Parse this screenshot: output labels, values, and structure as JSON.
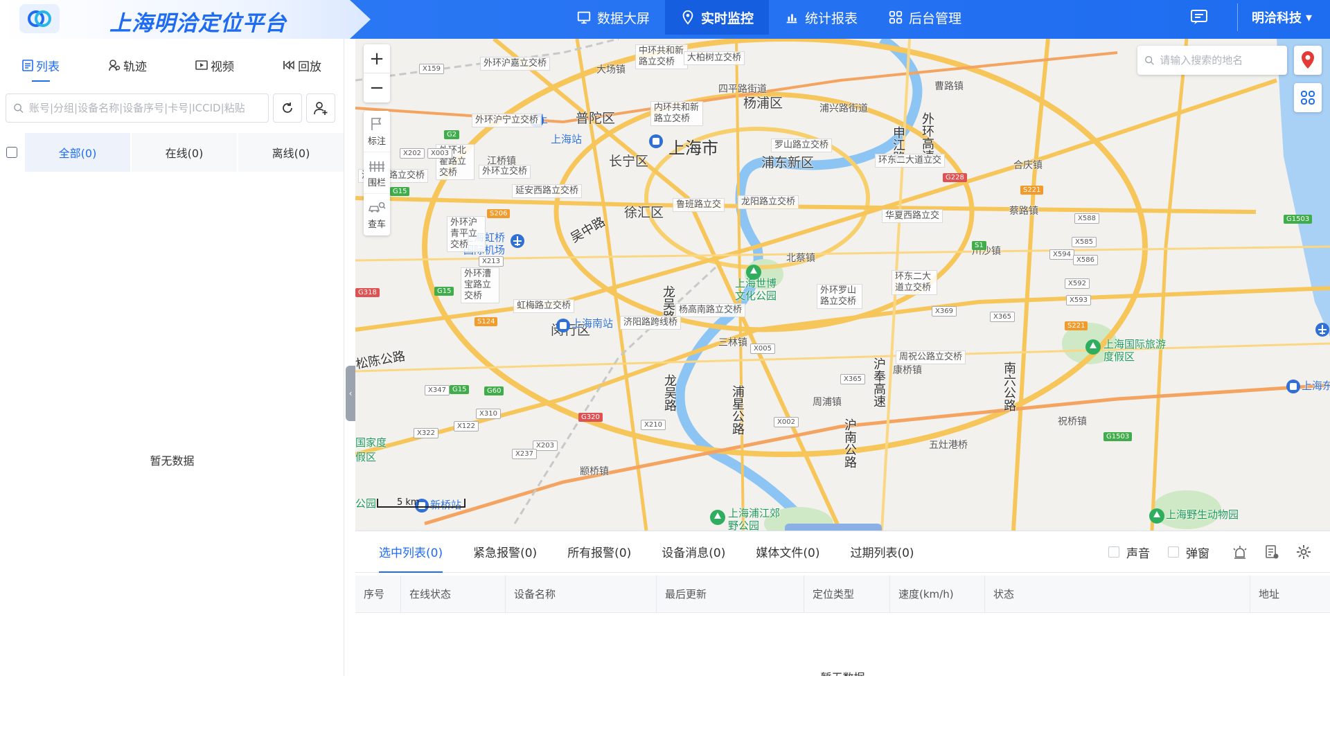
{
  "app": {
    "title": "上海明洽定位平台",
    "logo_icon": "cloud-link-icon",
    "accent": "#1f6cf2"
  },
  "nav": {
    "items": [
      {
        "label": "数据大屏",
        "icon": "monitor-icon"
      },
      {
        "label": "实时监控",
        "icon": "location-icon",
        "active": true
      },
      {
        "label": "统计报表",
        "icon": "chart-icon"
      },
      {
        "label": "后台管理",
        "icon": "grid-icon"
      }
    ],
    "user": "明洽科技"
  },
  "left": {
    "tabs": [
      {
        "label": "列表",
        "icon": "list-icon",
        "active": true
      },
      {
        "label": "轨迹",
        "icon": "track-icon"
      },
      {
        "label": "视频",
        "icon": "video-icon"
      },
      {
        "label": "回放",
        "icon": "rewind-icon"
      }
    ],
    "search_placeholder": "账号|分组|设备名称|设备序号|卡号|ICCID|粘贴",
    "filters": [
      {
        "label": "全部(0)",
        "active": true
      },
      {
        "label": "在线(0)"
      },
      {
        "label": "离线(0)"
      }
    ],
    "empty_text": "暂无数据"
  },
  "map": {
    "zoom_in": "+",
    "zoom_out": "−",
    "tools": [
      {
        "label": "标注",
        "icon": "flag-icon"
      },
      {
        "label": "围栏",
        "icon": "fence-icon"
      },
      {
        "label": "查车",
        "icon": "car-search-icon"
      }
    ],
    "search_placeholder": "请输入搜索的地名",
    "scale": "5 km",
    "labels": {
      "city": "上海市",
      "putuo": "普陀区",
      "changning": "长宁区",
      "xuhui": "徐汇区",
      "yangpu": "杨浦区",
      "pudong": "浦东新区",
      "minhang": "闵行区",
      "wuzhong": "吴中路",
      "longwu1": "龙吴路",
      "longwu2": "龙吴路",
      "puxing": "浦星公路",
      "hunan": "沪南公路",
      "sanlin": "三林镇",
      "beicai": "北蔡镇",
      "zhoupu": "周浦镇",
      "kangqiao": "康桥镇",
      "chuansha": "川沙镇",
      "heqing": "合庆镇",
      "cailu": "蔡路镇",
      "caolu": "曹路镇",
      "zhuqiao": "祝桥镇",
      "wuzaogang": "五灶港桥",
      "zhuanqiao": "颛桥镇",
      "jiangqiao": "江桥镇",
      "dachang": "大场镇",
      "siping": "四平路街道",
      "jiangpu": "浦兴路街道",
      "songpu": "松陈公路",
      "hongqiao_airport": "上海虹桥国际机场",
      "shanghai_station": "上海站",
      "shanghai_south": "上海南站",
      "xinqiao": "新桥站",
      "shanghai_east": "上海东站",
      "expo_park": "上海世博文化公园",
      "disney": "上海国际旅游度假区",
      "zoo": "上海野生动物园",
      "pujiang_park": "上海浦江郊野公园",
      "national": "国家度假区",
      "park_short": "公园",
      "shen_jiang": "申江路",
      "wai_huan": "外环高速",
      "hu_feng": "沪奉高速",
      "nan_liu": "南六公路",
      "shang": "上"
    },
    "interchanges": [
      "外环沪嘉立交桥",
      "中环共和新路立交桥",
      "大柏树立交桥",
      "内环共和新路立交桥",
      "外环沪宁立交桥",
      "罗山路立交桥",
      "环东二大道立交",
      "外环北翟路立交桥",
      "外环立交桥",
      "沪杭铁路立交桥",
      "延安西路立交桥",
      "鲁班路立交",
      "龙阳路立交桥",
      "华夏西路立交",
      "外环沪青平立交桥",
      "外环漕宝路立交桥",
      "环东二大道立交桥",
      "外环罗山路立交桥",
      "虹梅路立交桥",
      "杨高南路立交桥",
      "济阳路跨线桥",
      "周祝公路立交桥"
    ],
    "shields": [
      "X159",
      "G2",
      "X202",
      "X003",
      "G15",
      "S206",
      "X213",
      "G318",
      "G15",
      "S124",
      "X347",
      "G15",
      "G60",
      "X310",
      "X322",
      "X122",
      "X203",
      "X237",
      "G320",
      "X210",
      "X005",
      "X365",
      "X002",
      "G1503",
      "X588",
      "X585",
      "X594",
      "X586",
      "X592",
      "X593",
      "X369",
      "X365",
      "S221",
      "G1503",
      "S221",
      "G228",
      "S1"
    ]
  },
  "bottom": {
    "tabs": [
      {
        "label": "选中列表(0)",
        "active": true
      },
      {
        "label": "紧急报警(0)"
      },
      {
        "label": "所有报警(0)"
      },
      {
        "label": "设备消息(0)"
      },
      {
        "label": "媒体文件(0)"
      },
      {
        "label": "过期列表(0)"
      }
    ],
    "sound_label": "声音",
    "popup_label": "弹窗",
    "columns": [
      "序号",
      "在线状态",
      "设备名称",
      "最后更新",
      "定位类型",
      "速度(km/h)",
      "状态",
      "地址"
    ],
    "empty_text": "暂无数据"
  }
}
